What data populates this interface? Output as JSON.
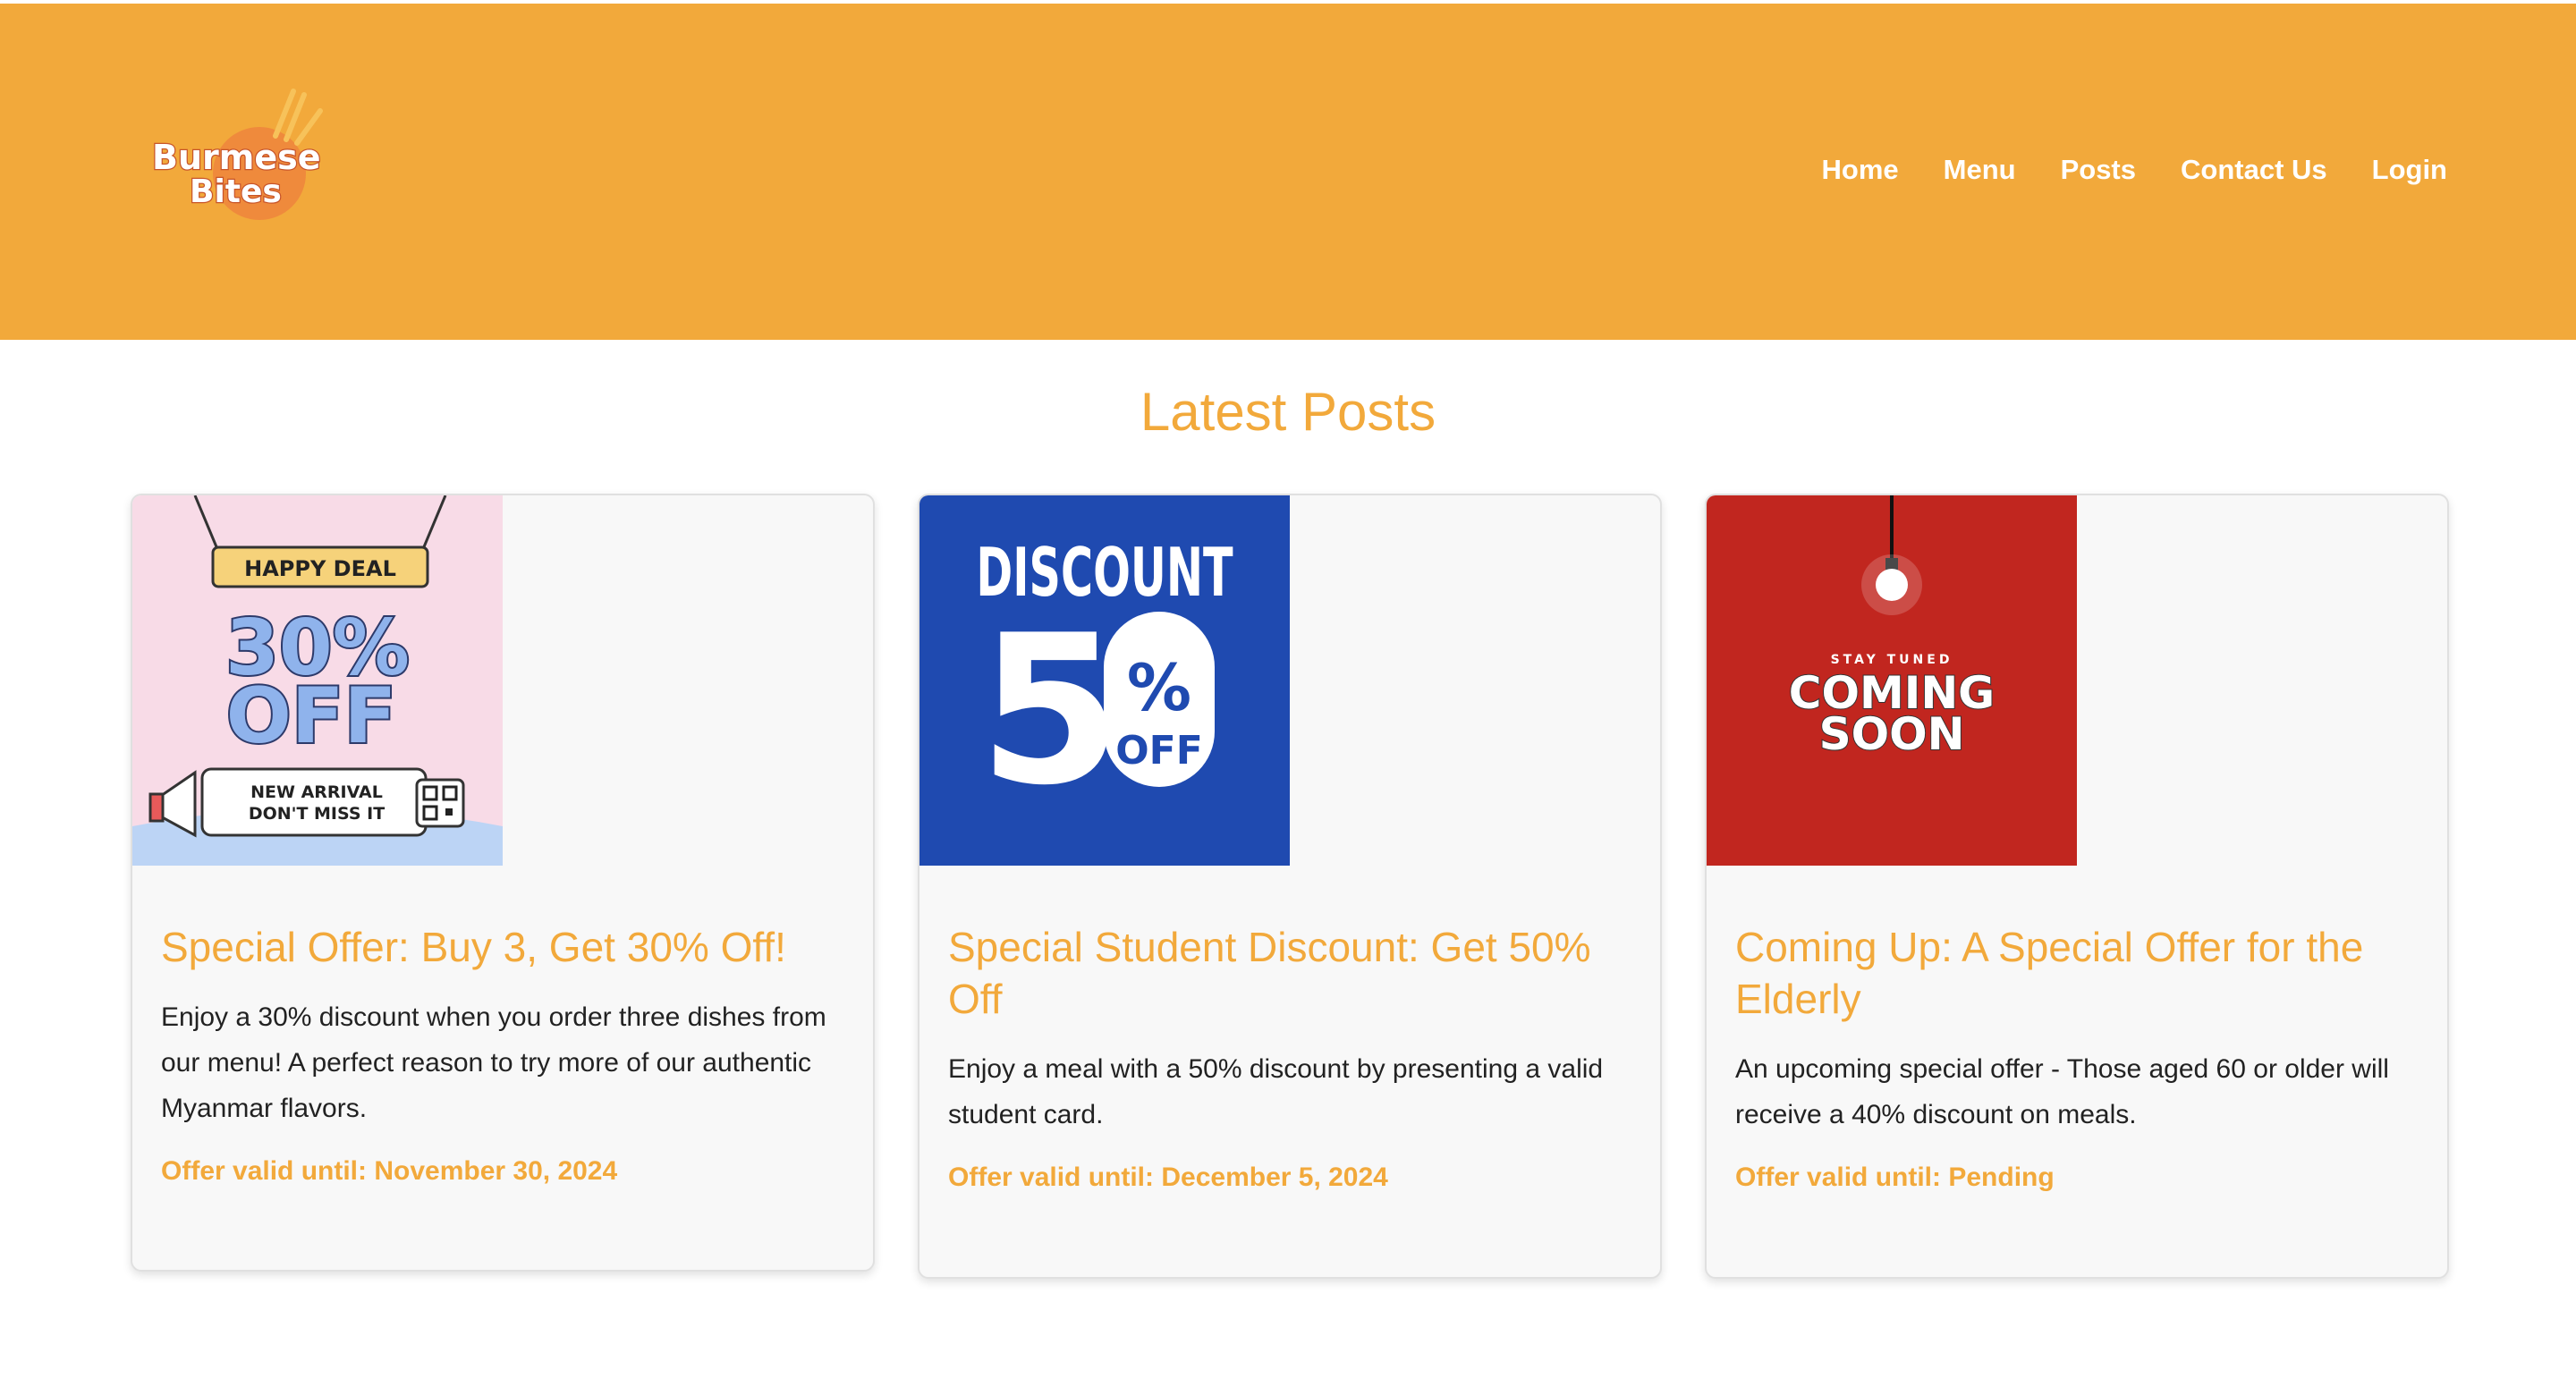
{
  "brand": {
    "logo_line1": "Burmese",
    "logo_line2": "Bites",
    "accent": "#f2a93b"
  },
  "nav": {
    "items": [
      {
        "label": "Home"
      },
      {
        "label": "Menu"
      },
      {
        "label": "Posts"
      },
      {
        "label": "Contact Us"
      },
      {
        "label": "Login"
      }
    ]
  },
  "main": {
    "title": "Latest Posts"
  },
  "posts": [
    {
      "title": "Special Offer: Buy 3, Get 30% Off!",
      "text": "Enjoy a 30% discount when you order three dishes from our menu! A perfect reason to try more of our authentic Myanmar flavors.",
      "valid": "Offer valid until: November 30, 2024",
      "image": {
        "banner": "HAPPY DEAL",
        "big": "30%",
        "big2": "OFF",
        "line1": "NEW ARRIVAL",
        "line2": "DON'T MISS IT"
      }
    },
    {
      "title": "Special Student Discount: Get 50% Off",
      "text": "Enjoy a meal with a 50% discount by presenting a valid student card.",
      "valid": "Offer valid until: December 5, 2024",
      "image": {
        "top": "DISCOUNT",
        "digit": "5",
        "zero": "0",
        "pct": "%",
        "off": "OFF"
      }
    },
    {
      "title": "Coming Up: A Special Offer for the Elderly",
      "text": "An upcoming special offer - Those aged 60 or older will receive a 40% discount on meals.",
      "valid": "Offer valid until: Pending",
      "image": {
        "small": "STAY TUNED",
        "line1": "COMING",
        "line2": "SOON"
      }
    }
  ]
}
